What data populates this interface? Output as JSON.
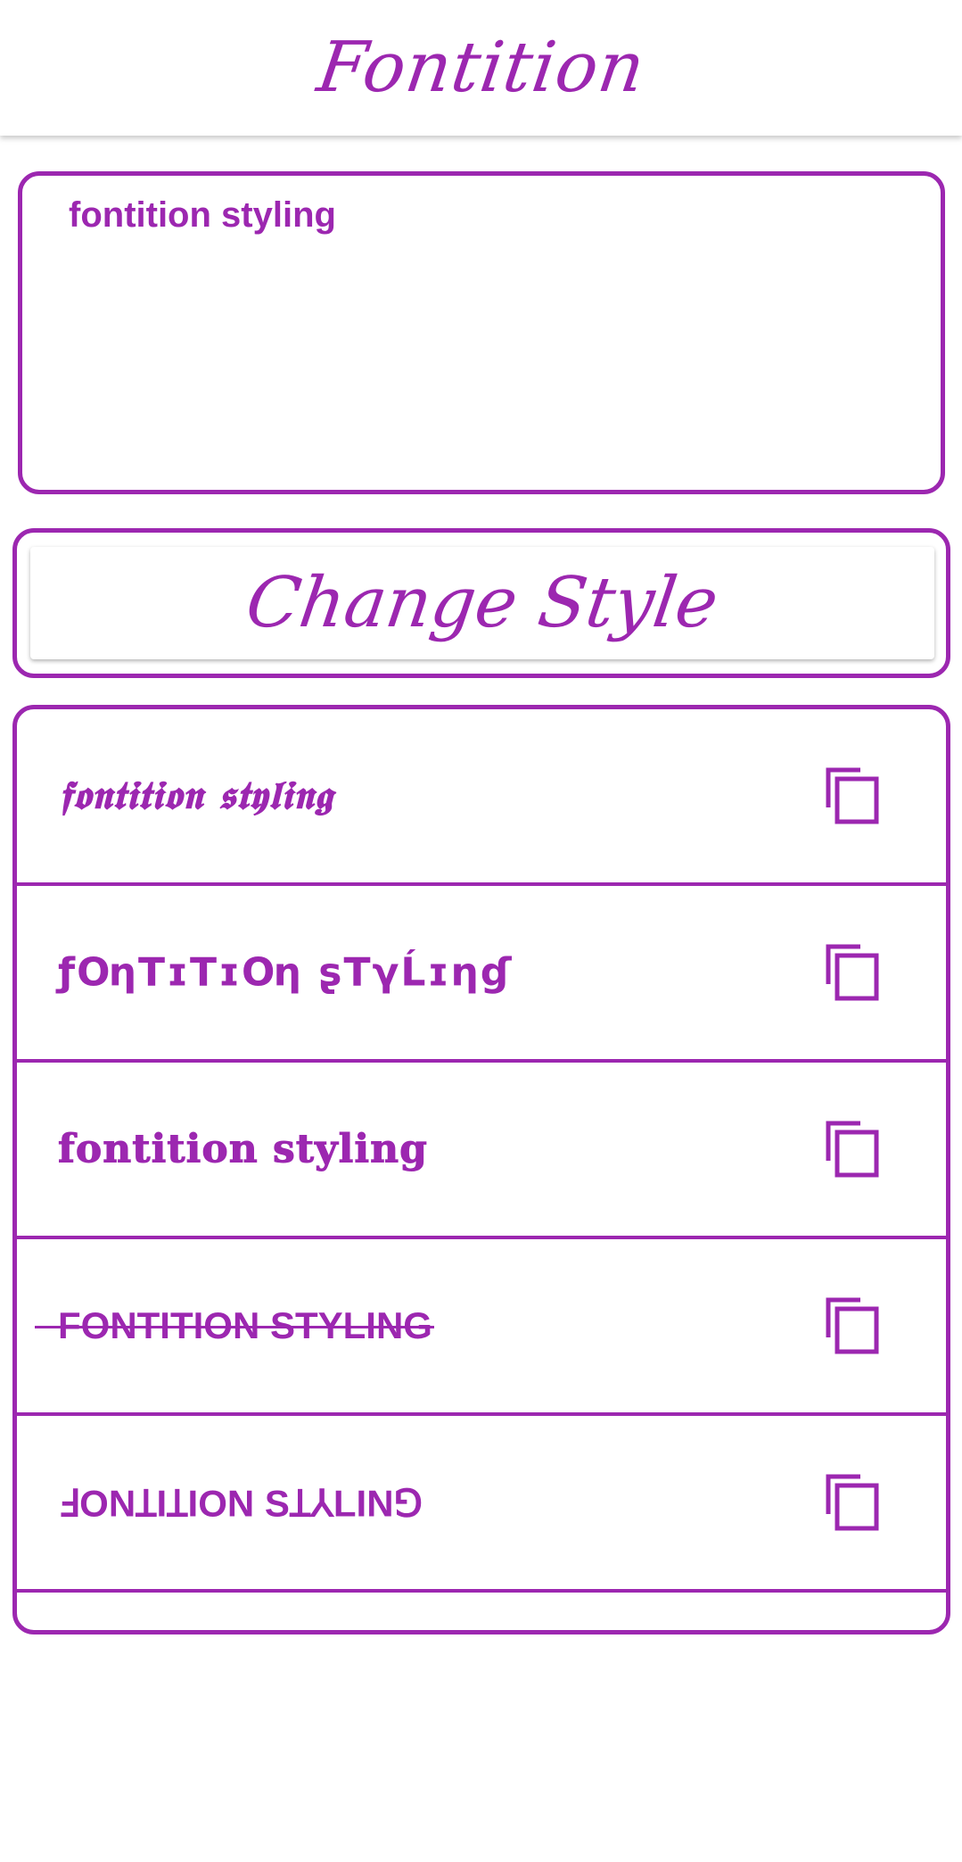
{
  "app": {
    "title": "Fontition"
  },
  "input": {
    "value": "fontition styling"
  },
  "change_button": {
    "label": "Change Style"
  },
  "accent_color": "#9c27b0",
  "results": [
    {
      "text": "𝖋𝖔𝖓𝖙𝖎𝖙𝖎𝖔𝖓 𝖘𝖙𝖞𝖑𝖎𝖓𝖌",
      "copy_icon": "copy-icon"
    },
    {
      "text": "ƒՕηТɪТɪՕη ʂТγĹɪηɠ",
      "copy_icon": "copy-icon"
    },
    {
      "text": "fontition styling",
      "copy_icon": "copy-icon"
    },
    {
      "text": "FONTITION STYLING",
      "copy_icon": "copy-icon"
    },
    {
      "text": "ℲONꞱIꞱION SꞱ⅄LIN⅁",
      "copy_icon": "copy-icon"
    }
  ]
}
